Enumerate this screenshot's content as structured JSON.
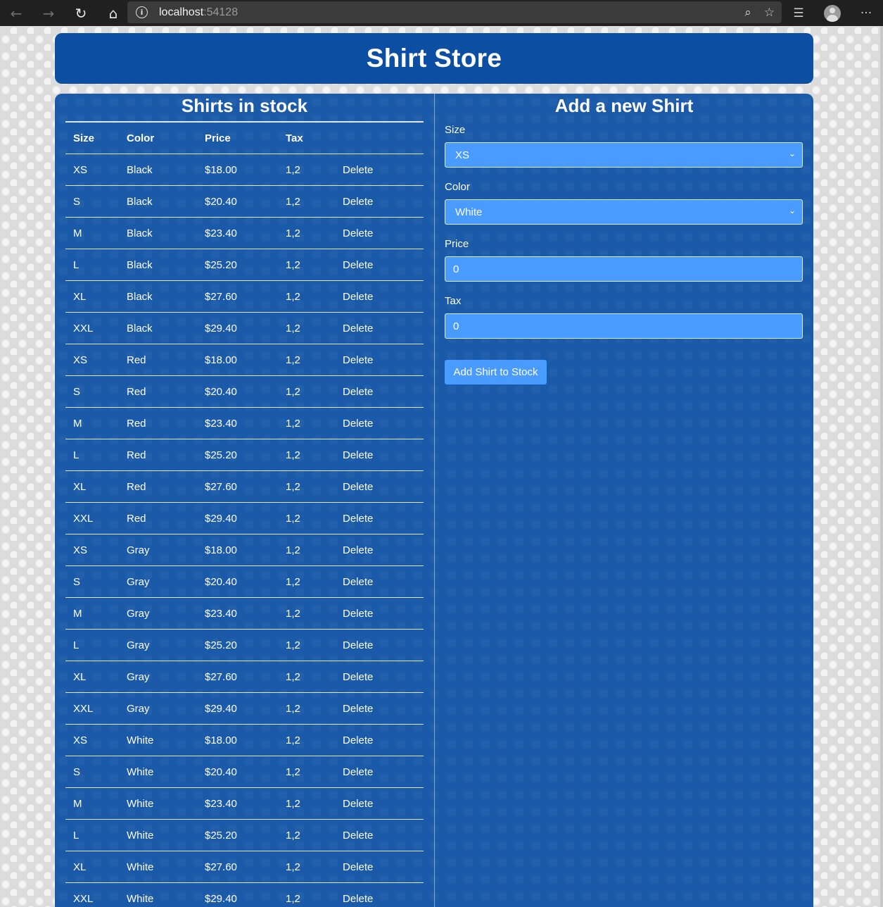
{
  "browser": {
    "url_host": "localhost",
    "url_port": ":54128",
    "icons": [
      "back-arrow",
      "forward-arrow",
      "refresh",
      "home",
      "info",
      "zoom",
      "favorite-star",
      "favorites-list",
      "profile",
      "more"
    ]
  },
  "header": {
    "title": "Shirt Store"
  },
  "stock": {
    "title": "Shirts in stock",
    "columns": [
      "Size",
      "Color",
      "Price",
      "Tax"
    ],
    "delete_label": "Delete",
    "rows": [
      [
        "XS",
        "Black",
        "$18.00",
        "1,2"
      ],
      [
        "S",
        "Black",
        "$20.40",
        "1,2"
      ],
      [
        "M",
        "Black",
        "$23.40",
        "1,2"
      ],
      [
        "L",
        "Black",
        "$25.20",
        "1,2"
      ],
      [
        "XL",
        "Black",
        "$27.60",
        "1,2"
      ],
      [
        "XXL",
        "Black",
        "$29.40",
        "1,2"
      ],
      [
        "XS",
        "Red",
        "$18.00",
        "1,2"
      ],
      [
        "S",
        "Red",
        "$20.40",
        "1,2"
      ],
      [
        "M",
        "Red",
        "$23.40",
        "1,2"
      ],
      [
        "L",
        "Red",
        "$25.20",
        "1,2"
      ],
      [
        "XL",
        "Red",
        "$27.60",
        "1,2"
      ],
      [
        "XXL",
        "Red",
        "$29.40",
        "1,2"
      ],
      [
        "XS",
        "Gray",
        "$18.00",
        "1,2"
      ],
      [
        "S",
        "Gray",
        "$20.40",
        "1,2"
      ],
      [
        "M",
        "Gray",
        "$23.40",
        "1,2"
      ],
      [
        "L",
        "Gray",
        "$25.20",
        "1,2"
      ],
      [
        "XL",
        "Gray",
        "$27.60",
        "1,2"
      ],
      [
        "XXL",
        "Gray",
        "$29.40",
        "1,2"
      ],
      [
        "XS",
        "White",
        "$18.00",
        "1,2"
      ],
      [
        "S",
        "White",
        "$20.40",
        "1,2"
      ],
      [
        "M",
        "White",
        "$23.40",
        "1,2"
      ],
      [
        "L",
        "White",
        "$25.20",
        "1,2"
      ],
      [
        "XL",
        "White",
        "$27.60",
        "1,2"
      ],
      [
        "XXL",
        "White",
        "$29.40",
        "1,2"
      ]
    ]
  },
  "form": {
    "title": "Add a new Shirt",
    "size_label": "Size",
    "size_value": "XS",
    "color_label": "Color",
    "color_value": "White",
    "price_label": "Price",
    "price_value": "0",
    "tax_label": "Tax",
    "tax_value": "0",
    "submit_label": "Add Shirt to Stock"
  },
  "colors": {
    "header_bg": "#0b4ea2",
    "panel_bg": "#1a5aa8",
    "field_bg": "#4a9bff",
    "text": "#ffffff"
  }
}
